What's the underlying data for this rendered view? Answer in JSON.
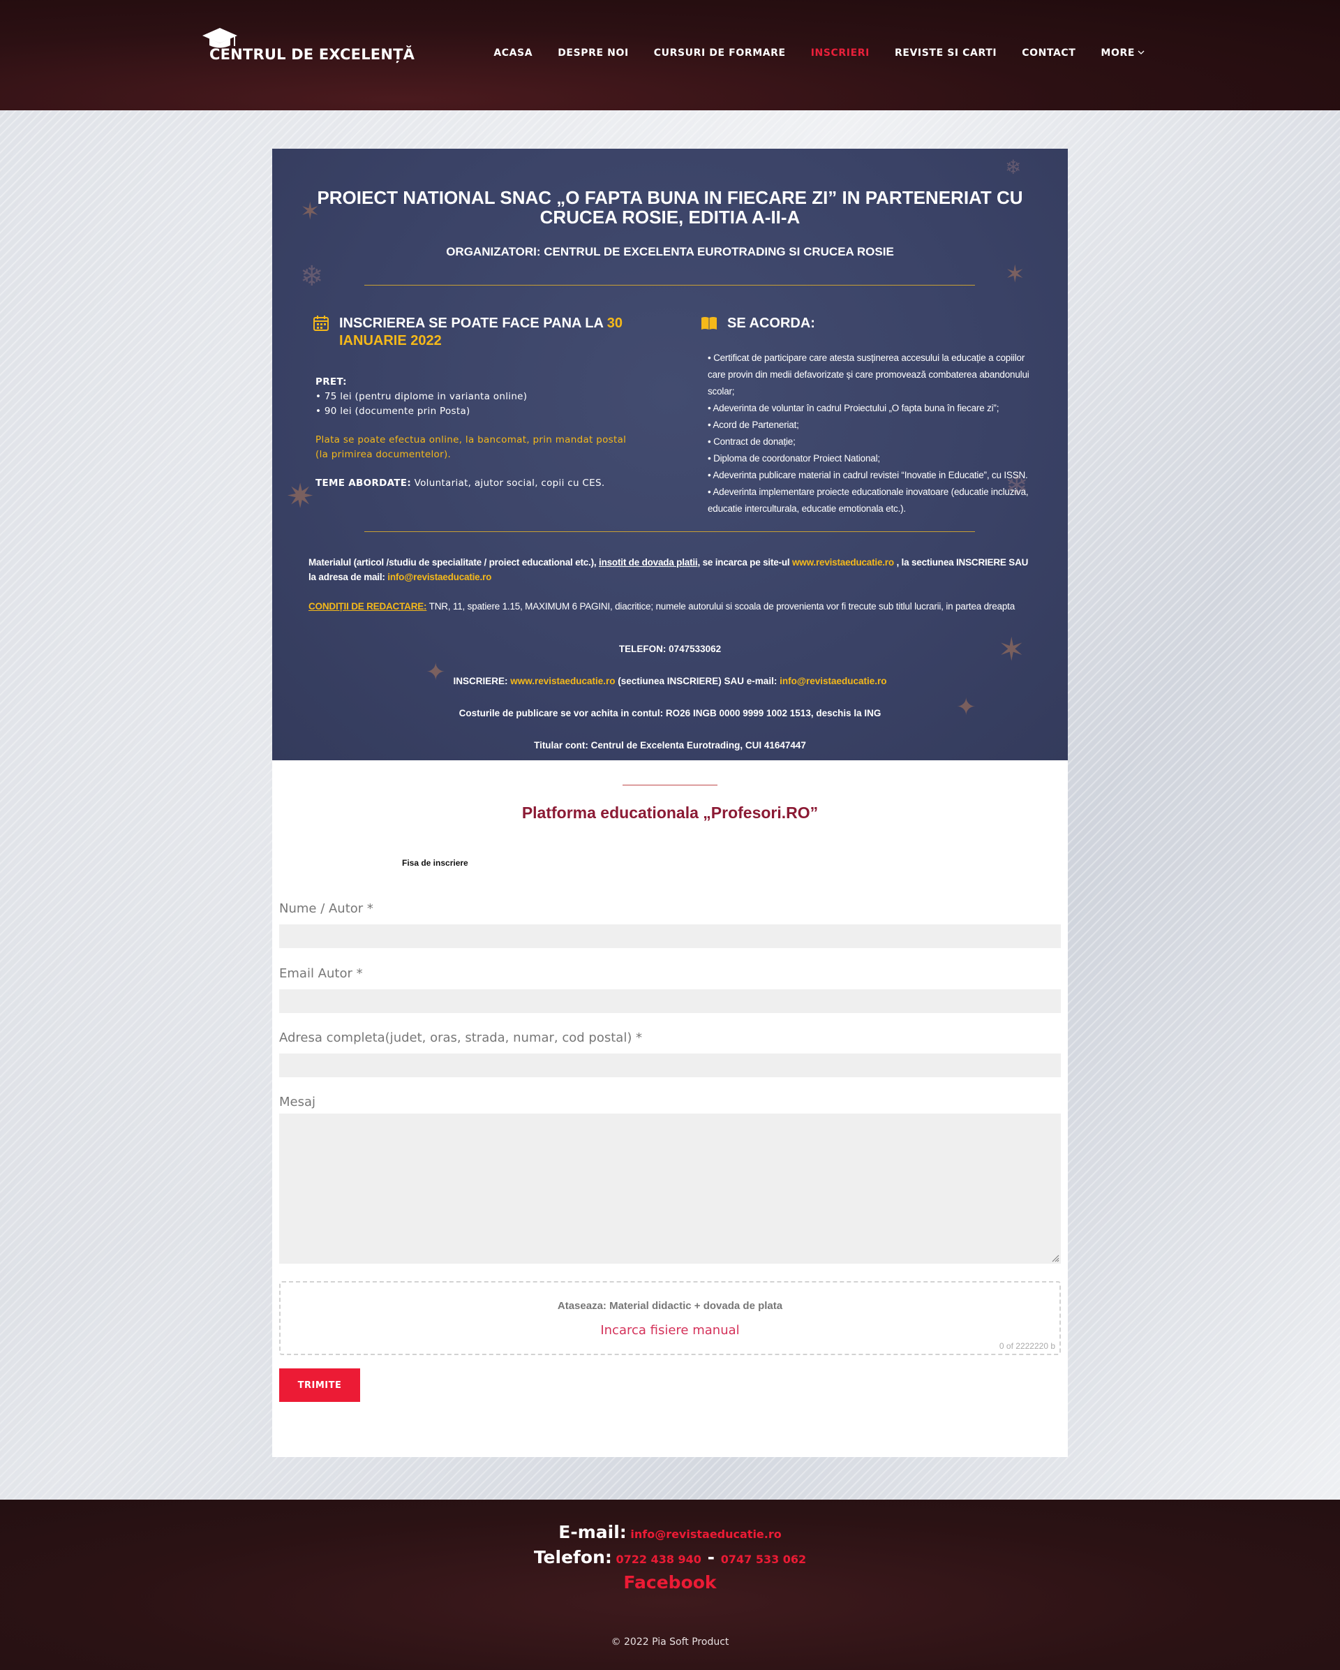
{
  "header": {
    "logo_text": "CENTRUL DE EXCELENȚĂ",
    "nav": [
      "ACASA",
      "DESPRE NOI",
      "CURSURI DE FORMARE",
      "INSCRIERI",
      "REVISTE SI CARTI",
      "CONTACT",
      "MORE"
    ],
    "active_nav": "INSCRIERI"
  },
  "banner": {
    "title": "PROIECT NATIONAL SNAC „O FAPTA BUNA IN FIECARE ZI” IN PARTENERIAT CU CRUCEA ROSIE, EDITIA A-II-A",
    "organizers": "ORGANIZATORI: CENTRUL DE EXCELENTA EUROTRADING SI CRUCEA ROSIE",
    "left": {
      "heading_prefix": "INSCRIEREA SE POATE FACE PANA LA ",
      "heading_date": "30 IANUARIE 2022",
      "price_label": "PRET:",
      "price_1": "• 75 lei (pentru diplome in varianta online)",
      "price_2": "• 90 lei (documente prin Posta)",
      "payment": "Plata se poate efectua online, la bancomat, prin mandat postal (la primirea documentelor).",
      "themes_label": "TEME ABORDATE:",
      "themes": " Voluntariat, ajutor social, copii cu CES."
    },
    "right": {
      "heading": "SE ACORDA:",
      "items": [
        "• Certificat de participare care atesta susținerea accesului la educație a copiilor care provin din medii defavorizate și care promovează combaterea abandonului scolar;",
        "• Adeverinta de voluntar în cadrul Proiectului „O fapta buna în fiecare zi”;",
        "• Acord de Parteneriat;",
        "• Contract de donație;",
        "• Diploma de coordonator Proiect National;",
        "• Adeverinta publicare material in cadrul revistei “Inovatie in Educatie”, cu ISSN.",
        "• Adeverinta implementare proiecte educationale inovatoare (educatie incluziva, educatie interculturala, educatie emotionala etc.)."
      ]
    },
    "material": {
      "part1": "Materialul (articol /studiu de specialitate / proiect educational etc.), ",
      "part2": "insotit de dovada platii",
      "part3": ", se incarca pe site-ul ",
      "site": "www.revistaeducatie.ro",
      "part4": " , la sectiunea INSCRIERE SAU la adresa de mail: ",
      "email": "info@revistaeducatie.ro"
    },
    "conditions": {
      "label": "CONDIȚII DE REDACTARE:",
      "text": " TNR, 11, spatiere 1.15, MAXIMUM 6 PAGINI, diacritice; numele autorului si scoala de provenienta vor fi trecute sub titlul lucrarii, in partea dreapta"
    },
    "phone": "TELEFON:  0747533062",
    "inscriere": {
      "label": "INSCRIERE: ",
      "site": "www.revistaeducatie.ro",
      "middle": " (sectiunea INSCRIERE) SAU e-mail: ",
      "email": "info@revistaeducatie.ro"
    },
    "account": "Costurile de publicare se vor achita in contul: RO26 INGB 0000 9999 1002 1513, deschis la ING",
    "holder": "Titular cont: Centrul de Excelenta Eurotrading, CUI 41647447"
  },
  "form": {
    "platform_title": "Platforma educationala „Profesori.RO”",
    "fisa": "Fisa de inscriere",
    "name_label": "Nume / Autor *",
    "email_label": "Email Autor *",
    "address_label": "Adresa completa(judet, oras, strada, numar, cod postal) *",
    "message_label": "Mesaj",
    "attach_title": "Ataseaza: Material didactic + dovada de plata",
    "attach_link": "Incarca fisiere manual",
    "attach_count": "0 of 2222220 b",
    "submit": "TRIMITE"
  },
  "footer": {
    "email_label": "E-mail:",
    "email": "info@revistaeducatie.ro",
    "phone_label": "Telefon:",
    "phone_1": "0722 438 940",
    "phone_sep": " - ",
    "phone_2": "0747 533 062",
    "facebook": "Facebook",
    "copyright": "© 2022 Pia Soft Product"
  },
  "colors": {
    "accent_red": "#ec1b35",
    "banner_blue": "#3e4669",
    "gold": "#f5b91a",
    "header_dark": "#2c1013"
  }
}
